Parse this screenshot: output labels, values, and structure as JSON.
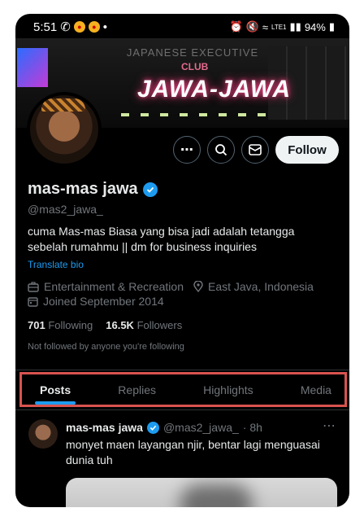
{
  "status_bar": {
    "time": "5:51",
    "battery": "94%",
    "network": "LTE1",
    "voice": "Vo0"
  },
  "banner": {
    "sign_top": "JAPANESE EXECUTIVE",
    "sign_club": "CLUB",
    "sign_main": "JAWA-JAWA"
  },
  "actions": {
    "more_label": "⋯",
    "follow_label": "Follow"
  },
  "profile": {
    "name": "mas-mas jawa",
    "handle": "@mas2_jawa_",
    "bio": "cuma Mas-mas Biasa yang bisa jadi adalah tetangga sebelah rumahmu || dm for business inquiries",
    "translate": "Translate bio",
    "category": "Entertainment & Recreation",
    "location": "East Java, Indonesia",
    "joined": "Joined September 2014",
    "following_count": "701",
    "following_label": "Following",
    "followers_count": "16.5K",
    "followers_label": "Followers",
    "not_followed": "Not followed by anyone you're following"
  },
  "tabs": [
    {
      "label": "Posts",
      "active": true
    },
    {
      "label": "Replies",
      "active": false
    },
    {
      "label": "Highlights",
      "active": false
    },
    {
      "label": "Media",
      "active": false
    }
  ],
  "post": {
    "name": "mas-mas jawa",
    "handle": "@mas2_jawa_",
    "time": "· 8h",
    "text": "monyet maen layangan njir, bentar lagi menguasai dunia tuh"
  },
  "colors": {
    "accent": "#1d9bf0",
    "highlight_border": "#d9534f",
    "background": "#000000"
  }
}
